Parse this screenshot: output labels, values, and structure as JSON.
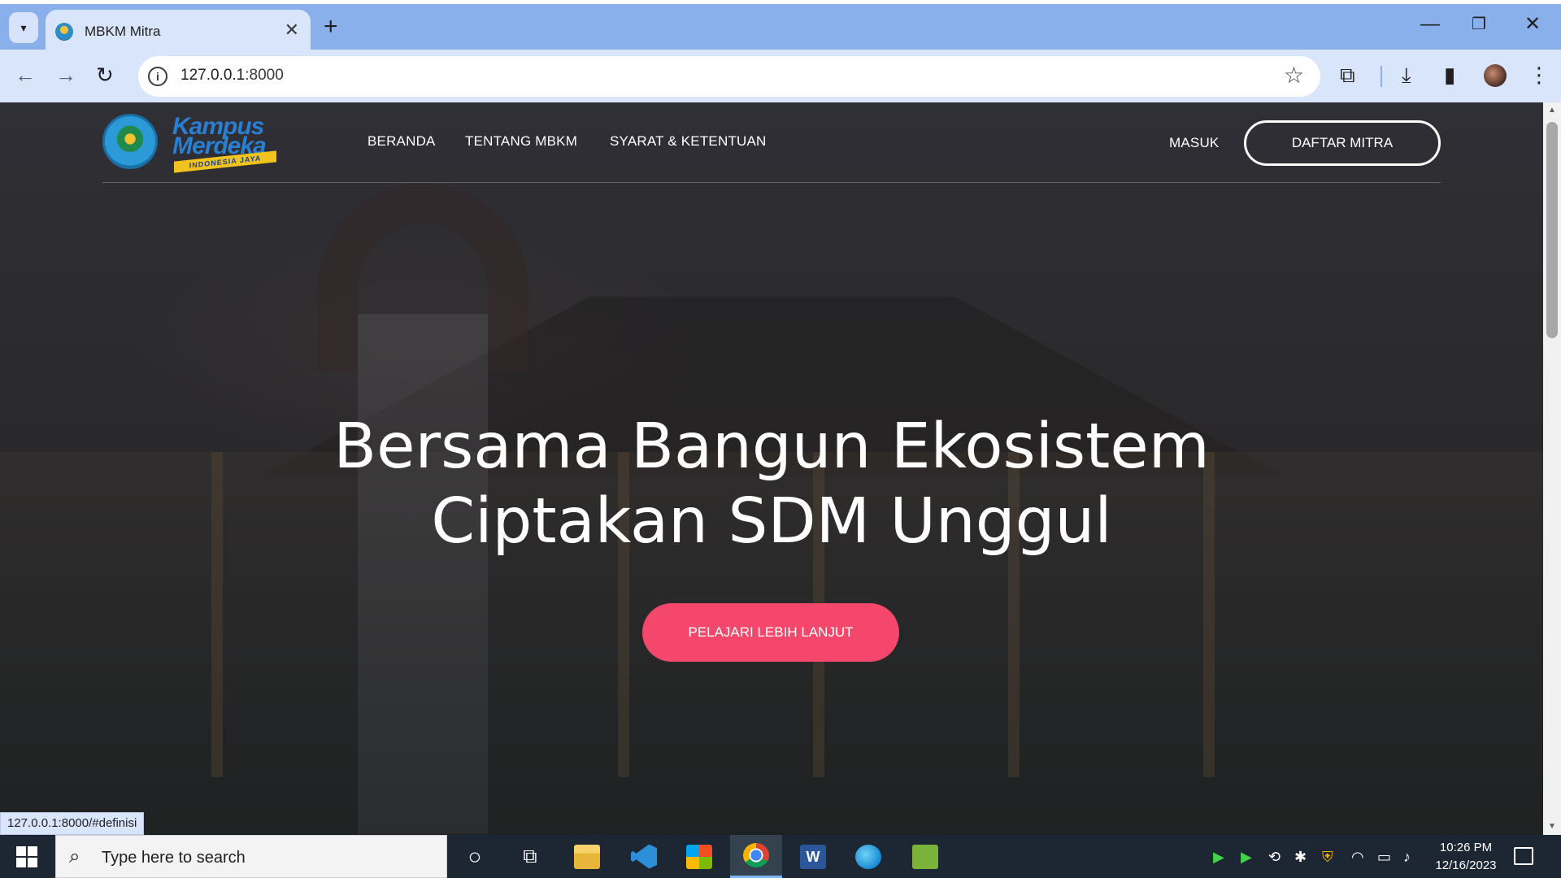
{
  "browser": {
    "tab_title": "MBKM Mitra",
    "tab_close": "✕",
    "new_tab": "+",
    "url_host": "127.0.0.1",
    "url_port": ":8000",
    "back": "←",
    "forward": "→",
    "reload": "↻",
    "star": "☆",
    "win_min": "—",
    "win_restore": "❐",
    "win_close": "✕",
    "extensions": "⧉",
    "download": "⤓",
    "sidepanel": "▮",
    "menu": "⋮"
  },
  "site": {
    "logo_kampus": "Kampus",
    "logo_merdeka": "Merdeka",
    "logo_ribbon": "INDONESIA JAYA",
    "nav": {
      "beranda": "BERANDA",
      "tentang": "TENTANG MBKM",
      "syarat": "SYARAT & KETENTUAN",
      "masuk": "MASUK",
      "daftar": "DAFTAR MITRA"
    },
    "hero": {
      "line1": "Bersama Bangun Ekosistem",
      "line2": "Ciptakan SDM Unggul",
      "button": "PELAJARI LEBIH LANJUT"
    }
  },
  "status_url": "127.0.0.1:8000/#definisi",
  "taskbar": {
    "search_placeholder": "Type here to search",
    "time": "10:26 PM",
    "date": "12/16/2023"
  },
  "colors": {
    "accent_pink": "#f4476b",
    "chrome_blue": "#8ab0ec",
    "toolbar_bg": "#d9e5fb",
    "taskbar_bg": "#1c2733"
  }
}
